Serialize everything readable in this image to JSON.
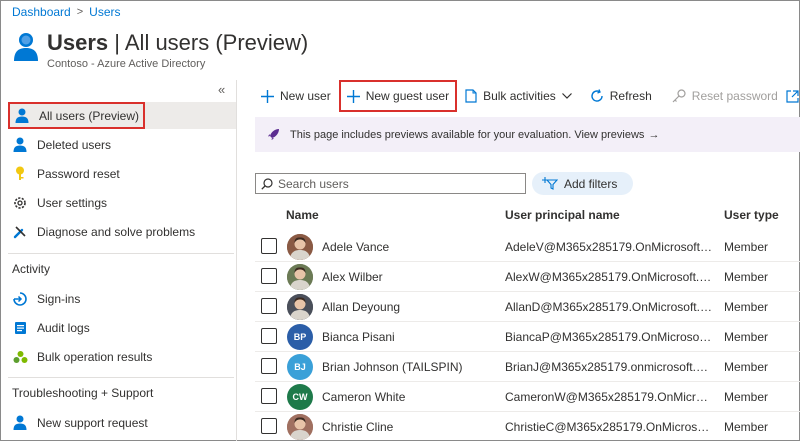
{
  "breadcrumb": {
    "items": [
      "Dashboard",
      "Users"
    ]
  },
  "header": {
    "title_bold": "Users",
    "title_rest": " | All users (Preview)",
    "subtitle": "Contoso - Azure Active Directory"
  },
  "sidebar": {
    "collapse_glyph": "«",
    "items": [
      {
        "label": "All users (Preview)",
        "icon": "user-icon"
      },
      {
        "label": "Deleted users",
        "icon": "deleted-user-icon"
      },
      {
        "label": "Password reset",
        "icon": "key-icon"
      },
      {
        "label": "User settings",
        "icon": "gear-icon"
      },
      {
        "label": "Diagnose and solve problems",
        "icon": "wrench-icon"
      }
    ],
    "activity": {
      "heading": "Activity",
      "items": [
        {
          "label": "Sign-ins",
          "icon": "sign-in-icon"
        },
        {
          "label": "Audit logs",
          "icon": "audit-log-icon"
        },
        {
          "label": "Bulk operation results",
          "icon": "bulk-results-icon"
        }
      ]
    },
    "support": {
      "heading": "Troubleshooting + Support",
      "items": [
        {
          "label": "New support request",
          "icon": "support-person-icon"
        }
      ]
    }
  },
  "toolbar": {
    "new_user": "New user",
    "new_guest_user": "New guest user",
    "bulk_activities": "Bulk activities",
    "refresh": "Refresh",
    "reset_password": "Reset password"
  },
  "banner": {
    "text": "This page includes previews available for your evaluation. View previews",
    "arrow": "→"
  },
  "search": {
    "placeholder": "Search users"
  },
  "filter": {
    "label": "Add filters"
  },
  "table": {
    "headers": {
      "name": "Name",
      "upn": "User principal name",
      "type": "User type"
    },
    "rows": [
      {
        "name": "Adele Vance",
        "upn": "AdeleV@M365x285179.OnMicrosoft.c...",
        "type": "Member",
        "initials": "",
        "avatar_color": "#8a5a44",
        "photo": true
      },
      {
        "name": "Alex Wilber",
        "upn": "AlexW@M365x285179.OnMicrosoft.c...",
        "type": "Member",
        "initials": "",
        "avatar_color": "#6b7a55",
        "photo": true
      },
      {
        "name": "Allan Deyoung",
        "upn": "AllanD@M365x285179.OnMicrosoft.c...",
        "type": "Member",
        "initials": "",
        "avatar_color": "#4a4f5a",
        "photo": true
      },
      {
        "name": "Bianca Pisani",
        "upn": "BiancaP@M365x285179.OnMicrosoft.c...",
        "type": "Member",
        "initials": "BP",
        "avatar_color": "#2b5ea8",
        "photo": false
      },
      {
        "name": "Brian Johnson (TAILSPIN)",
        "upn": "BrianJ@M365x285179.onmicrosoft.com",
        "type": "Member",
        "initials": "BJ",
        "avatar_color": "#3aa0d8",
        "photo": false
      },
      {
        "name": "Cameron White",
        "upn": "CameronW@M365x285179.OnMicrosoft...",
        "type": "Member",
        "initials": "CW",
        "avatar_color": "#1e7a4a",
        "photo": false
      },
      {
        "name": "Christie Cline",
        "upn": "ChristieC@M365x285179.OnMicrosoft.c...",
        "type": "Member",
        "initials": "",
        "avatar_color": "#a07060",
        "photo": true
      }
    ]
  }
}
